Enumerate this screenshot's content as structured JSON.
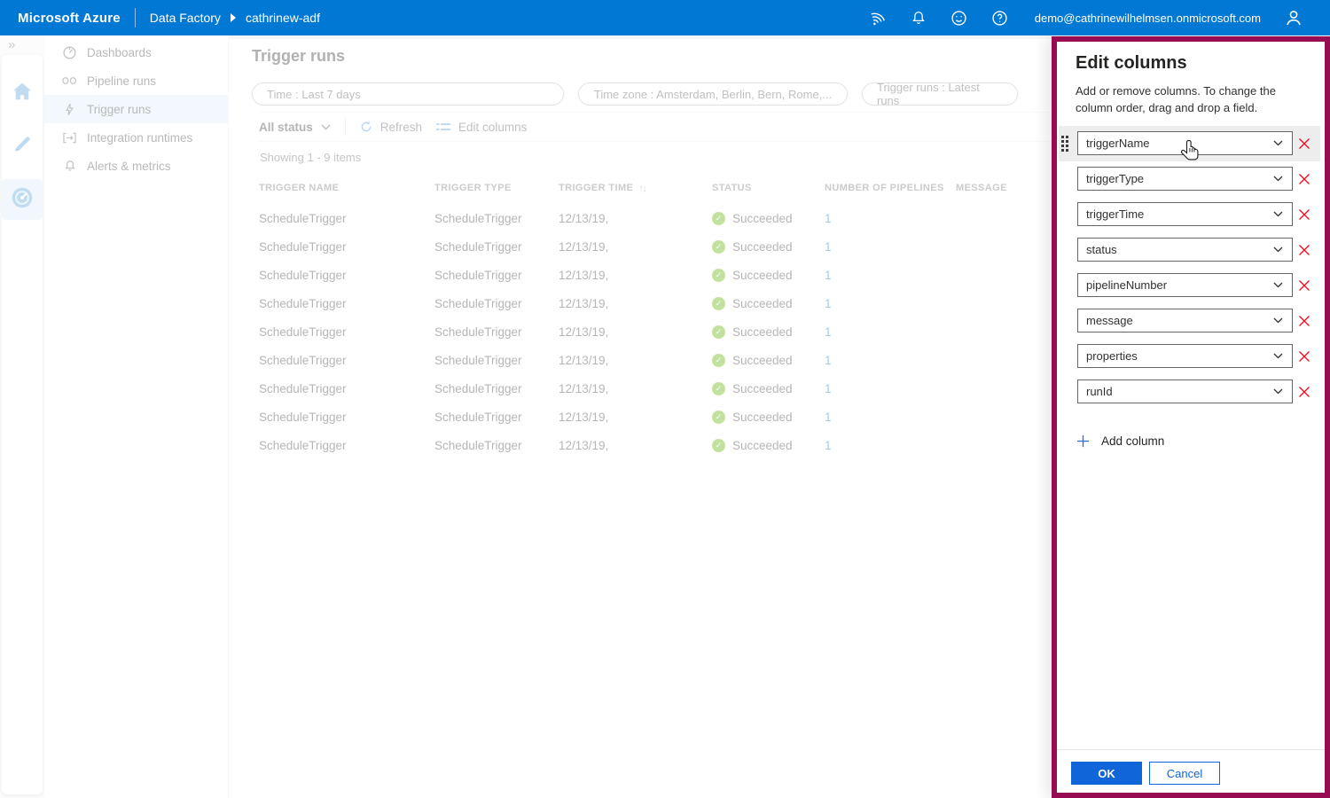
{
  "topbar": {
    "brand": "Microsoft Azure",
    "breadcrumb_app": "Data Factory",
    "breadcrumb_resource": "cathrinew-adf",
    "account_email": "demo@cathrinewilhelmsen.onmicrosoft.com"
  },
  "sidebar": {
    "items": [
      {
        "label": "Dashboards",
        "selected": false
      },
      {
        "label": "Pipeline runs",
        "selected": false
      },
      {
        "label": "Trigger runs",
        "selected": true
      },
      {
        "label": "Integration runtimes",
        "selected": false
      },
      {
        "label": "Alerts & metrics",
        "selected": false
      }
    ]
  },
  "main": {
    "title": "Trigger runs",
    "filters": [
      "Time : Last 7 days",
      "Time zone : Amsterdam, Berlin, Bern, Rome,...",
      "Trigger runs : Latest runs"
    ],
    "toolbar": {
      "status_filter": "All status",
      "refresh_label": "Refresh",
      "edit_columns_label": "Edit columns"
    },
    "items_count": "Showing 1 - 9 items",
    "table": {
      "columns": [
        "Trigger Name",
        "Trigger Type",
        "Trigger Time",
        "Status",
        "Number of Pipelines",
        "Message"
      ],
      "sorted_by": "Trigger Time",
      "rows": [
        {
          "trigger_name": "ScheduleTrigger",
          "trigger_type": "ScheduleTrigger",
          "trigger_time": "12/13/19,",
          "status": "Succeeded",
          "number_of_pipelines": "1",
          "message": ""
        },
        {
          "trigger_name": "ScheduleTrigger",
          "trigger_type": "ScheduleTrigger",
          "trigger_time": "12/13/19,",
          "status": "Succeeded",
          "number_of_pipelines": "1",
          "message": ""
        },
        {
          "trigger_name": "ScheduleTrigger",
          "trigger_type": "ScheduleTrigger",
          "trigger_time": "12/13/19,",
          "status": "Succeeded",
          "number_of_pipelines": "1",
          "message": ""
        },
        {
          "trigger_name": "ScheduleTrigger",
          "trigger_type": "ScheduleTrigger",
          "trigger_time": "12/13/19,",
          "status": "Succeeded",
          "number_of_pipelines": "1",
          "message": ""
        },
        {
          "trigger_name": "ScheduleTrigger",
          "trigger_type": "ScheduleTrigger",
          "trigger_time": "12/13/19,",
          "status": "Succeeded",
          "number_of_pipelines": "1",
          "message": ""
        },
        {
          "trigger_name": "ScheduleTrigger",
          "trigger_type": "ScheduleTrigger",
          "trigger_time": "12/13/19,",
          "status": "Succeeded",
          "number_of_pipelines": "1",
          "message": ""
        },
        {
          "trigger_name": "ScheduleTrigger",
          "trigger_type": "ScheduleTrigger",
          "trigger_time": "12/13/19,",
          "status": "Succeeded",
          "number_of_pipelines": "1",
          "message": ""
        },
        {
          "trigger_name": "ScheduleTrigger",
          "trigger_type": "ScheduleTrigger",
          "trigger_time": "12/13/19,",
          "status": "Succeeded",
          "number_of_pipelines": "1",
          "message": ""
        },
        {
          "trigger_name": "ScheduleTrigger",
          "trigger_type": "ScheduleTrigger",
          "trigger_time": "12/13/19,",
          "status": "Succeeded",
          "number_of_pipelines": "1",
          "message": ""
        }
      ]
    }
  },
  "panel": {
    "title": "Edit columns",
    "description": "Add or remove columns. To change the column order, drag and drop a field.",
    "fields": [
      "triggerName",
      "triggerType",
      "triggerTime",
      "status",
      "pipelineNumber",
      "message",
      "properties",
      "runId"
    ],
    "hovered_field": "triggerName",
    "add_column_label": "Add column",
    "ok_label": "OK",
    "cancel_label": "Cancel"
  },
  "colors": {
    "topbar_blue": "#0078d4",
    "panel_accent_border": "#970b52",
    "primary_button_blue": "#1065d9",
    "remove_icon_red": "#e81123",
    "status_success_green": "#5db300",
    "link_blue": "#0078d4"
  }
}
